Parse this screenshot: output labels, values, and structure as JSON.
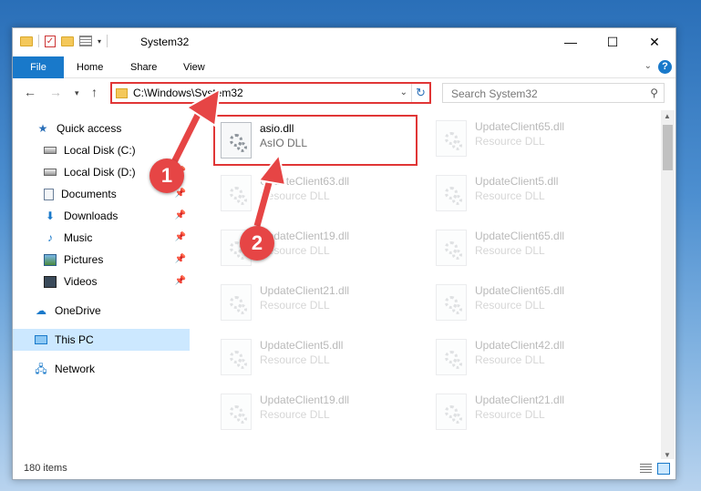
{
  "titlebar": {
    "title": "System32",
    "minimize": "—",
    "maximize": "☐",
    "close": "✕"
  },
  "ribbon": {
    "tabs": [
      {
        "label": "File"
      },
      {
        "label": "Home"
      },
      {
        "label": "Share"
      },
      {
        "label": "View"
      }
    ],
    "help": "?"
  },
  "address": {
    "path": "C:\\Windows\\System32",
    "search_placeholder": "Search System32"
  },
  "sidebar": {
    "items": [
      {
        "label": "Quick access"
      },
      {
        "label": "Local Disk (C:)"
      },
      {
        "label": "Local Disk (D:)"
      },
      {
        "label": "Documents"
      },
      {
        "label": "Downloads"
      },
      {
        "label": "Music"
      },
      {
        "label": "Pictures"
      },
      {
        "label": "Videos"
      },
      {
        "label": "OneDrive"
      },
      {
        "label": "This PC"
      },
      {
        "label": "Network"
      }
    ]
  },
  "files": [
    {
      "name": "asio.dll",
      "type": "AsIO DLL"
    },
    {
      "name": "UpdateClient65.dll",
      "type": "Resource DLL"
    },
    {
      "name": "UpdateClient63.dll",
      "type": "Resource DLL"
    },
    {
      "name": "UpdateClient5.dll",
      "type": "Resource DLL"
    },
    {
      "name": "UpdateClient19.dll",
      "type": "Resource DLL"
    },
    {
      "name": "UpdateClient65.dll",
      "type": "Resource DLL"
    },
    {
      "name": "UpdateClient21.dll",
      "type": "Resource DLL"
    },
    {
      "name": "UpdateClient65.dll",
      "type": "Resource DLL"
    },
    {
      "name": "UpdateClient5.dll",
      "type": "Resource DLL"
    },
    {
      "name": "UpdateClient42.dll",
      "type": "Resource DLL"
    },
    {
      "name": "UpdateClient19.dll",
      "type": "Resource DLL"
    },
    {
      "name": "UpdateClient21.dll",
      "type": "Resource DLL"
    }
  ],
  "status": {
    "count": "180 items"
  },
  "annotations": {
    "step1": "1",
    "step2": "2"
  },
  "colors": {
    "accent": "#1979ca",
    "highlight": "#e03636",
    "callout": "#e64545"
  }
}
